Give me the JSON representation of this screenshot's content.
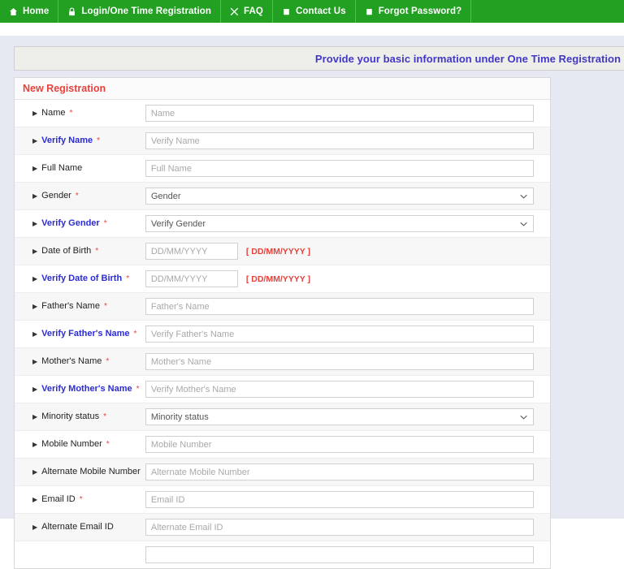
{
  "nav": {
    "items": [
      {
        "label": "Home",
        "icon": "home-icon"
      },
      {
        "label": "Login/One Time Registration",
        "icon": "lock-icon"
      },
      {
        "label": "FAQ",
        "icon": "scissors-icon"
      },
      {
        "label": "Contact Us",
        "icon": "note-icon"
      },
      {
        "label": "Forgot Password?",
        "icon": "note-icon"
      }
    ]
  },
  "banner": {
    "text": "Provide your basic information under One Time Registration"
  },
  "panel": {
    "title": "New Registration"
  },
  "colors": {
    "nav_green": "#22a022",
    "banner_text": "#4338c4",
    "title_red": "#e8413c",
    "verify_blue": "#2b2bd6",
    "page_bg": "#e6e9f2"
  },
  "form": {
    "fields": [
      {
        "label": "Name",
        "required": true,
        "verify": false,
        "type": "text",
        "placeholder": "Name"
      },
      {
        "label": "Verify Name",
        "required": true,
        "verify": true,
        "type": "text",
        "placeholder": "Verify Name"
      },
      {
        "label": "Full Name",
        "required": false,
        "verify": false,
        "type": "text",
        "placeholder": "Full Name"
      },
      {
        "label": "Gender",
        "required": true,
        "verify": false,
        "type": "select",
        "placeholder": "Gender"
      },
      {
        "label": "Verify Gender ",
        "required": true,
        "verify": true,
        "type": "select",
        "placeholder": "Verify Gender"
      },
      {
        "label": "Date of Birth",
        "required": true,
        "verify": false,
        "type": "date",
        "placeholder": "DD/MM/YYYY",
        "hint": "[ DD/MM/YYYY ]"
      },
      {
        "label": "Verify Date of Birth",
        "required": true,
        "verify": true,
        "type": "date",
        "placeholder": "DD/MM/YYYY",
        "hint": "[ DD/MM/YYYY ]"
      },
      {
        "label": "Father's Name",
        "required": true,
        "verify": false,
        "type": "text",
        "placeholder": "Father's Name"
      },
      {
        "label": "Verify Father's Name",
        "required": true,
        "verify": true,
        "type": "text",
        "placeholder": "Verify Father's Name"
      },
      {
        "label": "Mother's Name",
        "required": true,
        "verify": false,
        "type": "text",
        "placeholder": "Mother's Name"
      },
      {
        "label": "Verify Mother's Name",
        "required": true,
        "verify": true,
        "type": "text",
        "placeholder": "Verify Mother's Name"
      },
      {
        "label": "Minority status",
        "required": true,
        "verify": false,
        "type": "select",
        "placeholder": "Minority status"
      },
      {
        "label": "Mobile Number",
        "required": true,
        "verify": false,
        "type": "text",
        "placeholder": "Mobile Number"
      },
      {
        "label": "Alternate Mobile Number",
        "required": false,
        "verify": false,
        "type": "text",
        "placeholder": "Alternate Mobile Number"
      },
      {
        "label": "Email ID",
        "required": true,
        "verify": false,
        "type": "text",
        "placeholder": "Email ID"
      },
      {
        "label": "Alternate Email ID",
        "required": false,
        "verify": false,
        "type": "text",
        "placeholder": "Alternate Email ID"
      }
    ]
  }
}
